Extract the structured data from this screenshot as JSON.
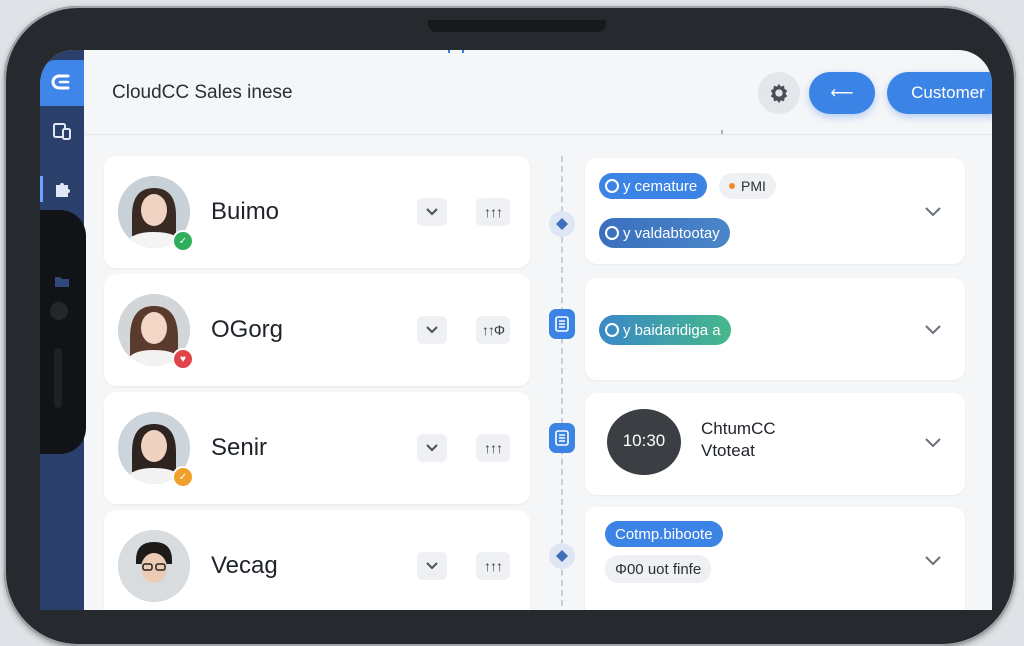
{
  "app": {
    "title": "CloudCC Sales inese",
    "accent": "#3c83e6",
    "sidebar_color": "#2b3f6b"
  },
  "sidebar": {
    "items": [
      {
        "icon": "logo-icon"
      },
      {
        "icon": "devices-icon"
      },
      {
        "icon": "puzzle-icon"
      },
      {
        "icon": "folder-icon"
      },
      {
        "icon": "record-icon"
      }
    ]
  },
  "header": {
    "settings_icon": "gear-icon",
    "back_label": "⟵",
    "customer_label": "Customer"
  },
  "contacts": [
    {
      "name": "Buimo",
      "status": "online",
      "status_color": "#2fae5c",
      "chevron": "chevron-down-icon",
      "sort_label": "↑↑↑"
    },
    {
      "name": "OGorg",
      "status": "busy",
      "status_color": "#e0454a",
      "chevron": "chevron-down-icon",
      "sort_label": "↑↑Φ"
    },
    {
      "name": "Senir",
      "status": "away",
      "status_color": "#f0a02a",
      "chevron": "chevron-down-icon",
      "sort_label": "↑↑↑"
    },
    {
      "name": "Vecag",
      "status": "none",
      "status_color": "",
      "chevron": "chevron-down-icon",
      "sort_label": "↑↑↑"
    }
  ],
  "timeline": {
    "items": [
      {
        "node": "diamond-icon",
        "chips": [
          {
            "label": "y cemature",
            "color": "#3c83e6"
          },
          {
            "label": "y valdabtootay",
            "color": "#3a79c9"
          }
        ],
        "meta": "PMI"
      },
      {
        "node": "document-icon",
        "chips": [
          {
            "label": "y baidaridiga a",
            "color": "#3aa3a0"
          }
        ]
      },
      {
        "node": "document-icon",
        "video": {
          "time": "10:30",
          "line1": "ChtumCC",
          "line2": "Vtoteat"
        }
      },
      {
        "node": "diamond-icon",
        "chips": [
          {
            "label": "Cotmp.biboote",
            "color": "#3c83e6"
          },
          {
            "label": "Φ00 uot finfe",
            "color": "#eef0f3"
          }
        ]
      }
    ]
  }
}
